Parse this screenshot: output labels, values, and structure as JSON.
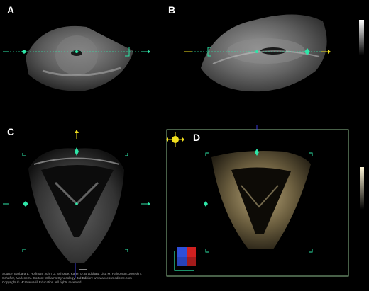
{
  "panels": {
    "a": "A",
    "b": "B",
    "c": "C",
    "d": "D"
  },
  "source_credit": {
    "line1": "Source: Barbara L. Hoffman, John O. Schorge, Karen D. Bradshaw, Lisa M. Halvorson, Joseph I.",
    "line2": "Schaffer, Marlene M. Corton: Williams Gynecology, 3rd Edition: www.accessmedicine.com",
    "line3": "Copyright © McGraw-Hill Education. All rights reserved."
  },
  "colors": {
    "marker": "#2ee6a8",
    "panel_d_border": "#8fbf8f",
    "arrow_yellow": "#f2e01e",
    "arrow_blue": "#3a3ad8"
  }
}
